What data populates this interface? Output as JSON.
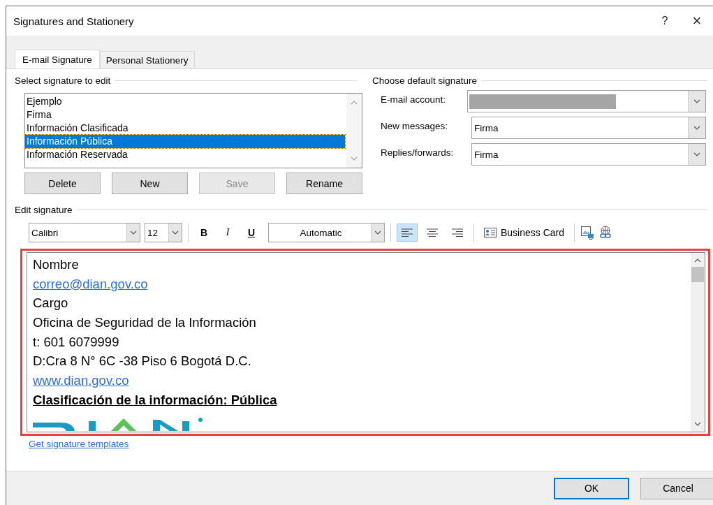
{
  "window": {
    "title": "Signatures and Stationery",
    "help": "?",
    "close": "×"
  },
  "tabs": [
    {
      "label": "E-mail Signature",
      "selected": true
    },
    {
      "label": "Personal Stationery",
      "selected": false
    }
  ],
  "select_signature": {
    "heading": "Select signature to edit",
    "items": [
      {
        "label": "Ejemplo",
        "selected": false
      },
      {
        "label": "Firma",
        "selected": false
      },
      {
        "label": "Información Clasificada",
        "selected": false
      },
      {
        "label": "Información Pública",
        "selected": true
      },
      {
        "label": "Información Reservada",
        "selected": false
      }
    ],
    "buttons": [
      {
        "label": "Delete",
        "disabled": false
      },
      {
        "label": "New",
        "disabled": false
      },
      {
        "label": "Save",
        "disabled": true
      },
      {
        "label": "Rename",
        "disabled": false
      }
    ]
  },
  "default_signature": {
    "heading": "Choose default signature",
    "fields": [
      {
        "label": "E-mail account:",
        "kind": "redacted"
      },
      {
        "label": "New messages:",
        "kind": "select",
        "value": "Firma"
      },
      {
        "label": "Replies/forwards:",
        "kind": "select",
        "value": "Firma"
      }
    ]
  },
  "edit_signature": {
    "heading": "Edit signature",
    "font": "Calibri",
    "size": "12",
    "bold": "B",
    "italic": "I",
    "underline": "U",
    "font_color": "Automatic",
    "align": [
      {
        "kind": "left",
        "selected": true
      },
      {
        "kind": "center",
        "selected": false
      },
      {
        "kind": "right",
        "selected": false
      }
    ],
    "business_card": "Business Card",
    "lines": [
      {
        "kind": "text",
        "text": "Nombre"
      },
      {
        "kind": "link",
        "text": "correo@dian.gov.co"
      },
      {
        "kind": "text",
        "text": "Cargo"
      },
      {
        "kind": "text",
        "text": "Oficina de Seguridad de la Información"
      },
      {
        "kind": "text",
        "text": "t: 601 6079999"
      },
      {
        "kind": "text",
        "text": "D:Cra 8 N° 6C -38 Piso 6 Bogotá D.C."
      },
      {
        "kind": "link",
        "text": "www.dian.gov.co"
      },
      {
        "kind": "heading",
        "text": "Clasificación de la información: Pública"
      },
      {
        "kind": "logo"
      }
    ]
  },
  "templates_link": "Get signature templates",
  "buttons": [
    {
      "label": "OK",
      "default": true
    },
    {
      "label": "Cancel",
      "default": false
    }
  ]
}
